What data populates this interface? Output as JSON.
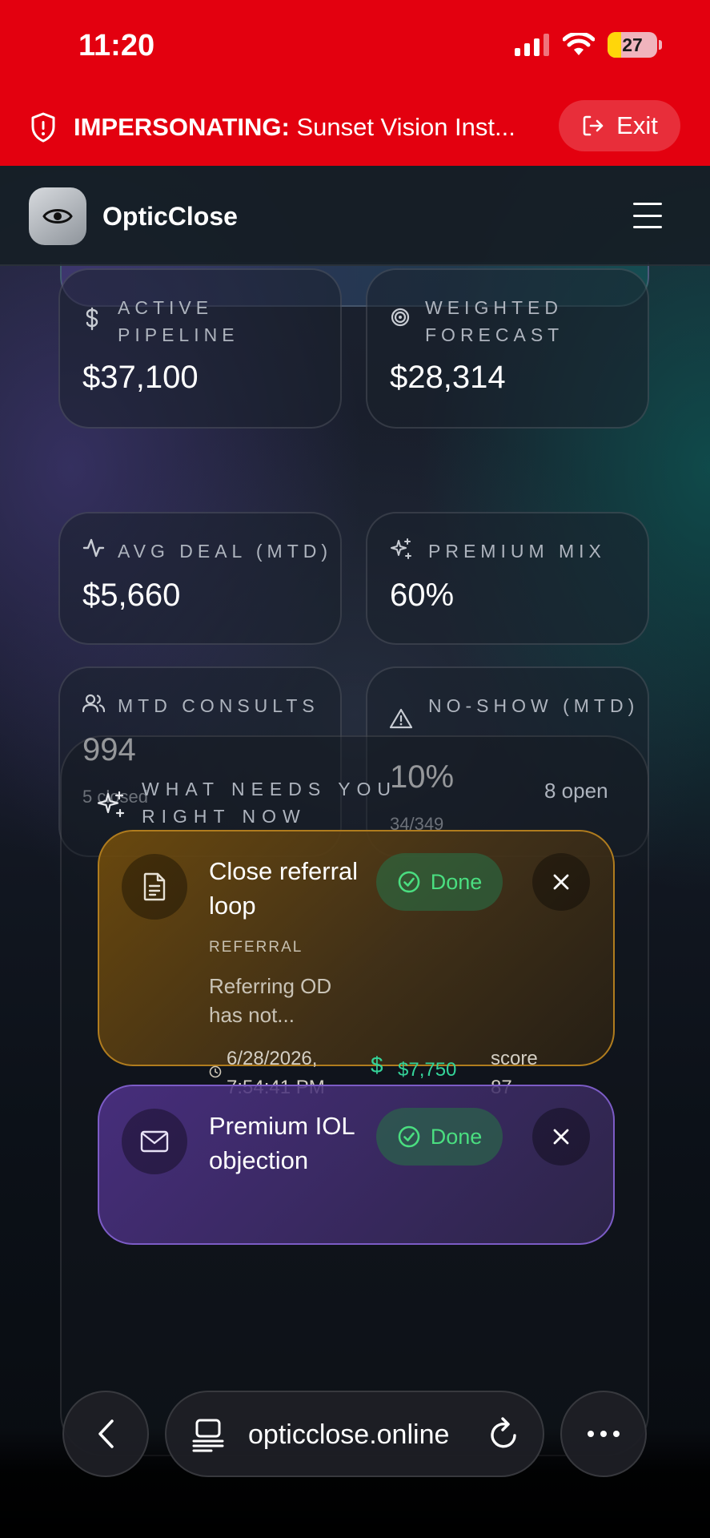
{
  "status_bar": {
    "time": "11:20",
    "battery": "27",
    "battery_level": 0.27
  },
  "impersonation": {
    "label": "IMPERSONATING:",
    "name": "Sunset Vision Inst...",
    "exit_label": "Exit"
  },
  "header": {
    "brand": "OpticClose"
  },
  "stats": [
    {
      "icon": "dollar-icon",
      "label": "ACTIVE PIPELINE",
      "value": "$37,100",
      "sub": ""
    },
    {
      "icon": "target-icon",
      "label": "WEIGHTED FORECAST",
      "value": "$28,314",
      "sub": ""
    },
    {
      "icon": "activity-icon",
      "label": "AVG DEAL (MTD)",
      "value": "$5,660",
      "sub": ""
    },
    {
      "icon": "sparkles-icon",
      "label": "PREMIUM MIX",
      "value": "60%",
      "sub": ""
    },
    {
      "icon": "users-icon",
      "label": "MTD CONSULTS",
      "value": "994",
      "sub": "5 closed"
    },
    {
      "icon": "alert-triangle-icon",
      "label": "NO-SHOW (MTD)",
      "value": "10%",
      "sub": "34/349"
    }
  ],
  "needs": {
    "title": "WHAT NEEDS YOU RIGHT NOW",
    "count": "8 open",
    "tasks": [
      {
        "icon": "document-icon",
        "title": "Close referral loop",
        "category": "REFERRAL",
        "description": "Referring OD has not...",
        "date": "6/28/2026, 7:54:41 PM",
        "amount": "$7,750",
        "score": "score 87",
        "done_label": "Done",
        "accent": "#b07c1e"
      },
      {
        "icon": "mail-icon",
        "title": "Premium IOL objection",
        "done_label": "Done",
        "accent": "#7c5cc6"
      }
    ]
  },
  "browser": {
    "url": "opticclose.online"
  }
}
